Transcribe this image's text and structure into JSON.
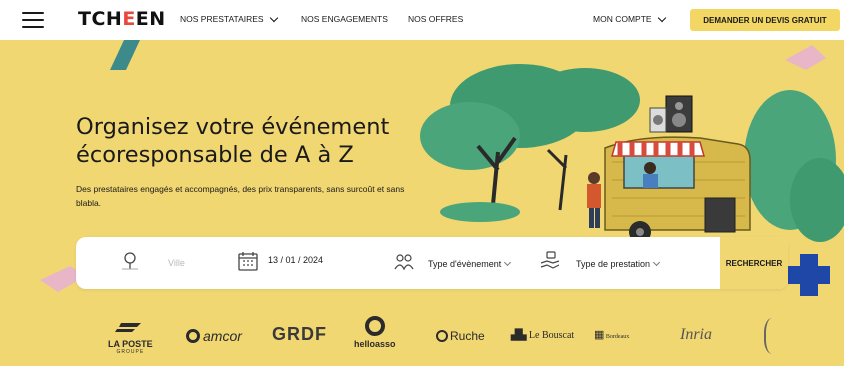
{
  "header": {
    "logo_text_a": "TCH",
    "logo_text_e": "E",
    "logo_text_b": "EN",
    "nav": [
      {
        "label": "NOS PRESTATAIRES",
        "has_dropdown": true
      },
      {
        "label": "NOS ENGAGEMENTS",
        "has_dropdown": false
      },
      {
        "label": "NOS OFFRES",
        "has_dropdown": false
      }
    ],
    "account_label": "MON COMPTE",
    "cta_label": "DEMANDER UN DEVIS GRATUIT"
  },
  "hero": {
    "title": "Organisez votre événement écoresponsable de A à Z",
    "subtitle": "Des prestataires engagés et accompagnés, des prix transparents, sans surcoût et sans blabla."
  },
  "search": {
    "city_placeholder": "Ville",
    "date_value": "13 / 01 / 2024",
    "event_type_label": "Type d'évènement",
    "service_type_label": "Type de prestation",
    "search_button": "RECHERCHER"
  },
  "partners": [
    {
      "name": "LA POSTE",
      "sub": "GROUPE"
    },
    {
      "name": "amcor"
    },
    {
      "name": "GRDF"
    },
    {
      "name": "helloasso"
    },
    {
      "name": "Ruche"
    },
    {
      "name": "Le Bouscat"
    },
    {
      "name": "Bordeaux"
    },
    {
      "name": "Inria"
    }
  ],
  "colors": {
    "hero_bg": "#f1d772",
    "cta_bg": "#f3d764",
    "accent_blue": "#1f47a8",
    "accent_teal": "#3d8a8a",
    "accent_pink": "#e9b6c8",
    "tree_green": "#3f9a70",
    "logo_red": "#e8473e"
  }
}
